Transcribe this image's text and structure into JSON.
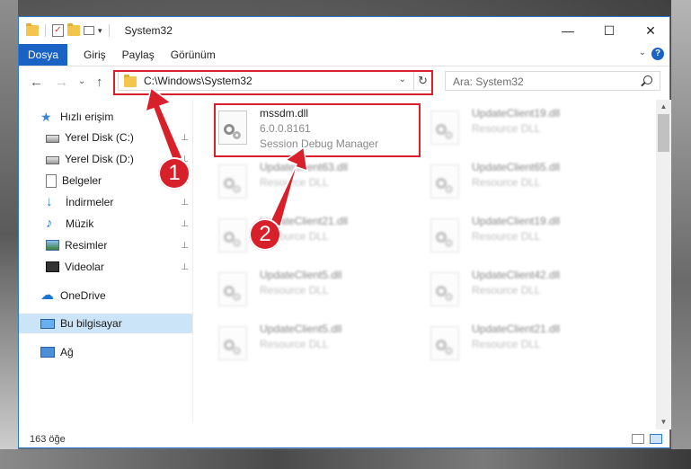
{
  "window": {
    "title": "System32",
    "controls": {
      "minimize": "—",
      "maximize": "☐",
      "close": "✕"
    }
  },
  "quick_access_toolbar": {
    "dropdown": "▾"
  },
  "ribbon": {
    "tabs": [
      "Dosya",
      "Giriş",
      "Paylaş",
      "Görünüm"
    ],
    "expand": "⌄",
    "help": "?"
  },
  "navigation": {
    "back": "←",
    "forward": "→",
    "recent": "⌄",
    "up": "↑",
    "address": "C:\\Windows\\System32",
    "address_dropdown": "⌄",
    "refresh": "↻",
    "search_placeholder": "Ara: System32"
  },
  "sidebar": {
    "items": [
      {
        "label": "Hızlı erişim",
        "icon": "star-icon",
        "pinned": false
      },
      {
        "label": "Yerel Disk (C:)",
        "icon": "drive-icon",
        "pinned": true
      },
      {
        "label": "Yerel Disk (D:)",
        "icon": "drive-icon",
        "pinned": true
      },
      {
        "label": "Belgeler",
        "icon": "document-icon",
        "pinned": true
      },
      {
        "label": "İndirmeler",
        "icon": "download-icon",
        "pinned": true
      },
      {
        "label": "Müzik",
        "icon": "music-icon",
        "pinned": true
      },
      {
        "label": "Resimler",
        "icon": "pictures-icon",
        "pinned": true
      },
      {
        "label": "Videolar",
        "icon": "videos-icon",
        "pinned": true
      },
      {
        "label": "OneDrive",
        "icon": "cloud-icon",
        "pinned": false
      },
      {
        "label": "Bu bilgisayar",
        "icon": "computer-icon",
        "pinned": false,
        "selected": true
      },
      {
        "label": "Ağ",
        "icon": "network-icon",
        "pinned": false
      }
    ],
    "pin_glyph": "📌"
  },
  "files": [
    {
      "name": "mssdm.dll",
      "line2": "6.0.0.8161",
      "line3": "Session Debug Manager",
      "highlighted": true
    },
    {
      "name": "UpdateClient19.dll",
      "line2": "Resource DLL"
    },
    {
      "name": "UpdateClient63.dll",
      "line2": "Resource DLL"
    },
    {
      "name": "UpdateClient65.dll",
      "line2": "Resource DLL"
    },
    {
      "name": "UpdateClient21.dll",
      "line2": "Resource DLL"
    },
    {
      "name": "UpdateClient19.dll",
      "line2": "Resource DLL"
    },
    {
      "name": "UpdateClient5.dll",
      "line2": "Resource DLL"
    },
    {
      "name": "UpdateClient42.dll",
      "line2": "Resource DLL"
    },
    {
      "name": "UpdateClient5.dll",
      "line2": "Resource DLL"
    },
    {
      "name": "UpdateClient21.dll",
      "line2": "Resource DLL"
    }
  ],
  "status": {
    "item_count": "163 öğe"
  },
  "annotations": {
    "step1": "1",
    "step2": "2",
    "color": "#d8202a"
  },
  "colors": {
    "accent": "#1a63c4",
    "selection": "#cce4f7",
    "highlight": "#d8202a"
  }
}
